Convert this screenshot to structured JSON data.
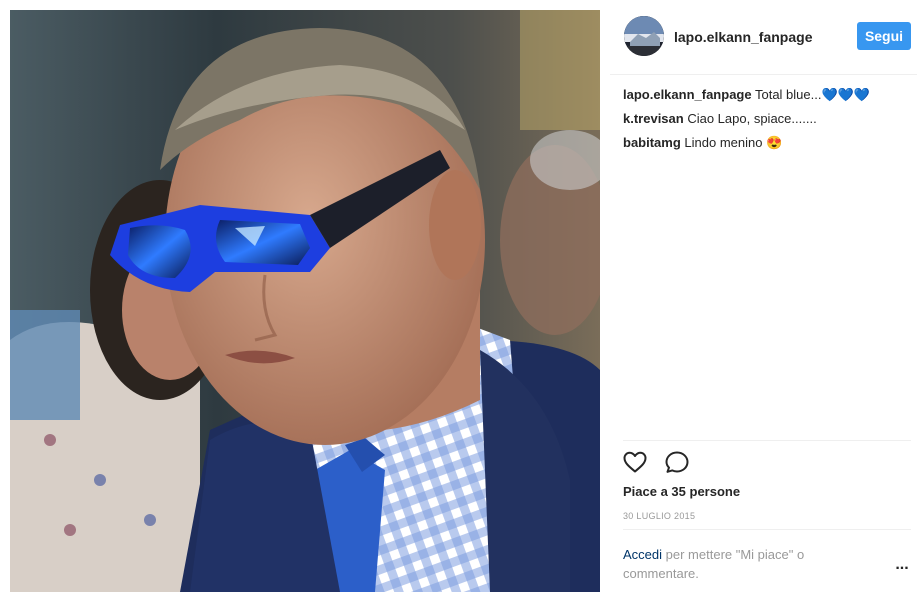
{
  "post": {
    "username": "lapo.elkann_fanpage",
    "follow_label": "Segui",
    "comments": [
      {
        "author": "lapo.elkann_fanpage",
        "text": "Total blue...💙💙💙"
      },
      {
        "author": "k.trevisan",
        "text": "Ciao Lapo, spiace......."
      },
      {
        "author": "babitamg",
        "text": "Lindo menino 😍"
      }
    ],
    "likes_text": "Piace a 35 persone",
    "date": "30 LUGLIO 2015",
    "login_link": "Accedi",
    "login_rest": "per mettere \"Mi piace\" o commentare.",
    "more_label": "..."
  },
  "icons": {
    "like": "heart-icon",
    "comment": "comment-icon",
    "more": "more-options-icon"
  },
  "colors": {
    "follow_button": "#3897f0",
    "login_link": "#003569",
    "muted_text": "#999999",
    "divider": "#efefef"
  }
}
